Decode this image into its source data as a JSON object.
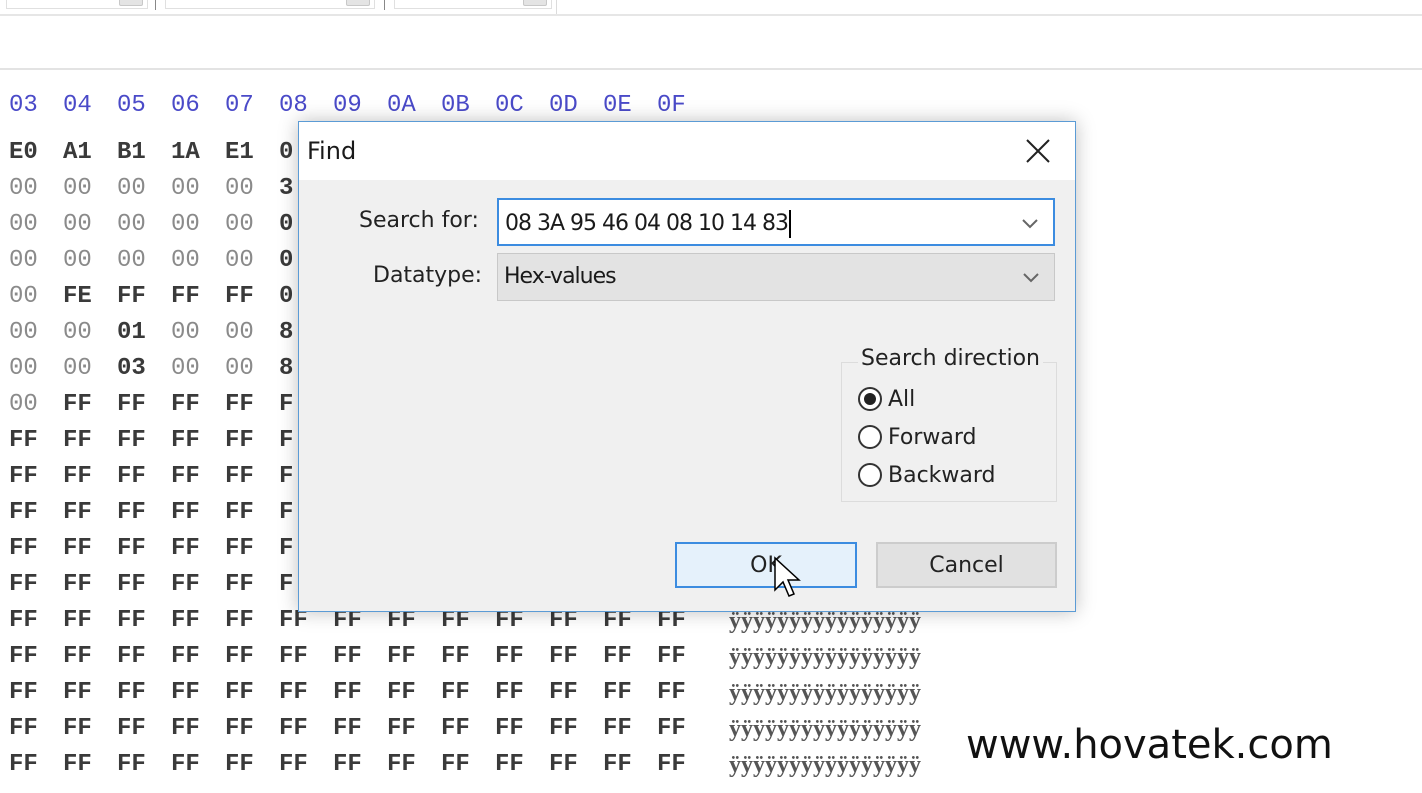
{
  "hex_view": {
    "column_headers": [
      "03",
      "04",
      "05",
      "06",
      "07",
      "08",
      "09",
      "0A",
      "0B",
      "0C",
      "0D",
      "0E",
      "0F"
    ],
    "rows": [
      {
        "bytes": [
          "E0",
          "A1",
          "B1",
          "1A",
          "E1",
          "0"
        ],
        "ascii": ""
      },
      {
        "bytes": [
          "00",
          "00",
          "00",
          "00",
          "00",
          "3"
        ],
        "ascii": ""
      },
      {
        "bytes": [
          "00",
          "00",
          "00",
          "00",
          "00",
          "0"
        ],
        "ascii": ""
      },
      {
        "bytes": [
          "00",
          "00",
          "00",
          "00",
          "00",
          "0"
        ],
        "ascii": ""
      },
      {
        "bytes": [
          "00",
          "FE",
          "FF",
          "FF",
          "FF",
          "0"
        ],
        "ascii": ""
      },
      {
        "bytes": [
          "00",
          "00",
          "01",
          "00",
          "00",
          "8"
        ],
        "ascii": ""
      },
      {
        "bytes": [
          "00",
          "00",
          "03",
          "00",
          "00",
          "8"
        ],
        "ascii": ""
      },
      {
        "bytes": [
          "00",
          "FF",
          "FF",
          "FF",
          "FF",
          "F"
        ],
        "ascii": ""
      },
      {
        "bytes": [
          "FF",
          "FF",
          "FF",
          "FF",
          "FF",
          "F"
        ],
        "ascii": ""
      },
      {
        "bytes": [
          "FF",
          "FF",
          "FF",
          "FF",
          "FF",
          "F"
        ],
        "ascii": ""
      },
      {
        "bytes": [
          "FF",
          "FF",
          "FF",
          "FF",
          "FF",
          "F"
        ],
        "ascii": ""
      },
      {
        "bytes": [
          "FF",
          "FF",
          "FF",
          "FF",
          "FF",
          "F"
        ],
        "ascii": ""
      },
      {
        "bytes": [
          "FF",
          "FF",
          "FF",
          "FF",
          "FF",
          "F"
        ],
        "ascii": ""
      },
      {
        "bytes": [
          "FF",
          "FF",
          "FF",
          "FF",
          "FF",
          "FF",
          "FF",
          "FF",
          "FF",
          "FF",
          "FF",
          "FF",
          "FF"
        ],
        "ascii": "ÿÿÿÿÿÿÿÿÿÿÿÿÿÿÿÿ"
      },
      {
        "bytes": [
          "FF",
          "FF",
          "FF",
          "FF",
          "FF",
          "FF",
          "FF",
          "FF",
          "FF",
          "FF",
          "FF",
          "FF",
          "FF"
        ],
        "ascii": "ÿÿÿÿÿÿÿÿÿÿÿÿÿÿÿÿ"
      },
      {
        "bytes": [
          "FF",
          "FF",
          "FF",
          "FF",
          "FF",
          "FF",
          "FF",
          "FF",
          "FF",
          "FF",
          "FF",
          "FF",
          "FF"
        ],
        "ascii": "ÿÿÿÿÿÿÿÿÿÿÿÿÿÿÿÿ"
      },
      {
        "bytes": [
          "FF",
          "FF",
          "FF",
          "FF",
          "FF",
          "FF",
          "FF",
          "FF",
          "FF",
          "FF",
          "FF",
          "FF",
          "FF"
        ],
        "ascii": "ÿÿÿÿÿÿÿÿÿÿÿÿÿÿÿÿ"
      },
      {
        "bytes": [
          "FF",
          "FF",
          "FF",
          "FF",
          "FF",
          "FF",
          "FF",
          "FF",
          "FF",
          "FF",
          "FF",
          "FF",
          "FF"
        ],
        "ascii": "ÿÿÿÿÿÿÿÿÿÿÿÿÿÿÿÿ"
      }
    ],
    "colors": {
      "header": "#4a4ac8",
      "byte": "#3a3a3a",
      "zero_byte": "#8a8a8a"
    }
  },
  "find_dialog": {
    "title": "Find",
    "close_icon": "close-icon",
    "search_for_label": "Search for:",
    "search_for_value": "08 3A 95 46 04 08 10 14 83",
    "datatype_label": "Datatype:",
    "datatype_value": "Hex-values",
    "search_direction": {
      "legend": "Search direction",
      "options": [
        {
          "label": "All",
          "selected": true
        },
        {
          "label": "Forward",
          "selected": false
        },
        {
          "label": "Backward",
          "selected": false
        }
      ]
    },
    "ok_label": "OK",
    "cancel_label": "Cancel",
    "accent": "#3c8ce0"
  },
  "watermark": "www.hovatek.com"
}
